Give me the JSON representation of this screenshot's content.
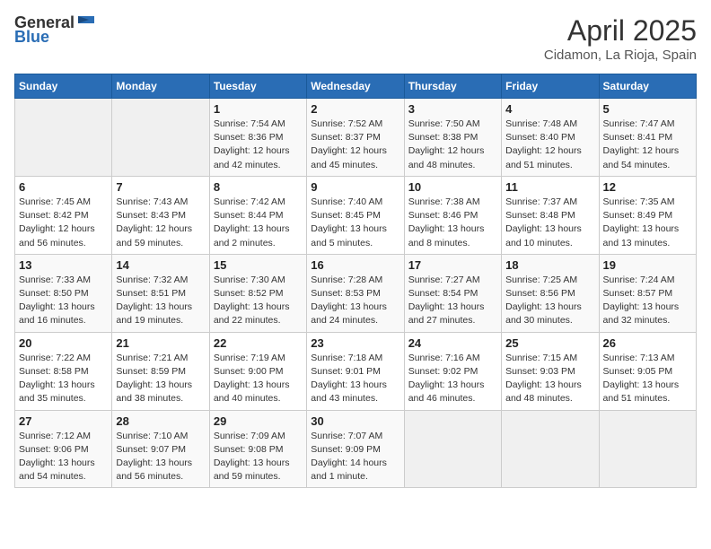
{
  "header": {
    "logo_general": "General",
    "logo_blue": "Blue",
    "month": "April 2025",
    "location": "Cidamon, La Rioja, Spain"
  },
  "weekdays": [
    "Sunday",
    "Monday",
    "Tuesday",
    "Wednesday",
    "Thursday",
    "Friday",
    "Saturday"
  ],
  "weeks": [
    [
      {
        "day": "",
        "info": ""
      },
      {
        "day": "",
        "info": ""
      },
      {
        "day": "1",
        "info": "Sunrise: 7:54 AM\nSunset: 8:36 PM\nDaylight: 12 hours and 42 minutes."
      },
      {
        "day": "2",
        "info": "Sunrise: 7:52 AM\nSunset: 8:37 PM\nDaylight: 12 hours and 45 minutes."
      },
      {
        "day": "3",
        "info": "Sunrise: 7:50 AM\nSunset: 8:38 PM\nDaylight: 12 hours and 48 minutes."
      },
      {
        "day": "4",
        "info": "Sunrise: 7:48 AM\nSunset: 8:40 PM\nDaylight: 12 hours and 51 minutes."
      },
      {
        "day": "5",
        "info": "Sunrise: 7:47 AM\nSunset: 8:41 PM\nDaylight: 12 hours and 54 minutes."
      }
    ],
    [
      {
        "day": "6",
        "info": "Sunrise: 7:45 AM\nSunset: 8:42 PM\nDaylight: 12 hours and 56 minutes."
      },
      {
        "day": "7",
        "info": "Sunrise: 7:43 AM\nSunset: 8:43 PM\nDaylight: 12 hours and 59 minutes."
      },
      {
        "day": "8",
        "info": "Sunrise: 7:42 AM\nSunset: 8:44 PM\nDaylight: 13 hours and 2 minutes."
      },
      {
        "day": "9",
        "info": "Sunrise: 7:40 AM\nSunset: 8:45 PM\nDaylight: 13 hours and 5 minutes."
      },
      {
        "day": "10",
        "info": "Sunrise: 7:38 AM\nSunset: 8:46 PM\nDaylight: 13 hours and 8 minutes."
      },
      {
        "day": "11",
        "info": "Sunrise: 7:37 AM\nSunset: 8:48 PM\nDaylight: 13 hours and 10 minutes."
      },
      {
        "day": "12",
        "info": "Sunrise: 7:35 AM\nSunset: 8:49 PM\nDaylight: 13 hours and 13 minutes."
      }
    ],
    [
      {
        "day": "13",
        "info": "Sunrise: 7:33 AM\nSunset: 8:50 PM\nDaylight: 13 hours and 16 minutes."
      },
      {
        "day": "14",
        "info": "Sunrise: 7:32 AM\nSunset: 8:51 PM\nDaylight: 13 hours and 19 minutes."
      },
      {
        "day": "15",
        "info": "Sunrise: 7:30 AM\nSunset: 8:52 PM\nDaylight: 13 hours and 22 minutes."
      },
      {
        "day": "16",
        "info": "Sunrise: 7:28 AM\nSunset: 8:53 PM\nDaylight: 13 hours and 24 minutes."
      },
      {
        "day": "17",
        "info": "Sunrise: 7:27 AM\nSunset: 8:54 PM\nDaylight: 13 hours and 27 minutes."
      },
      {
        "day": "18",
        "info": "Sunrise: 7:25 AM\nSunset: 8:56 PM\nDaylight: 13 hours and 30 minutes."
      },
      {
        "day": "19",
        "info": "Sunrise: 7:24 AM\nSunset: 8:57 PM\nDaylight: 13 hours and 32 minutes."
      }
    ],
    [
      {
        "day": "20",
        "info": "Sunrise: 7:22 AM\nSunset: 8:58 PM\nDaylight: 13 hours and 35 minutes."
      },
      {
        "day": "21",
        "info": "Sunrise: 7:21 AM\nSunset: 8:59 PM\nDaylight: 13 hours and 38 minutes."
      },
      {
        "day": "22",
        "info": "Sunrise: 7:19 AM\nSunset: 9:00 PM\nDaylight: 13 hours and 40 minutes."
      },
      {
        "day": "23",
        "info": "Sunrise: 7:18 AM\nSunset: 9:01 PM\nDaylight: 13 hours and 43 minutes."
      },
      {
        "day": "24",
        "info": "Sunrise: 7:16 AM\nSunset: 9:02 PM\nDaylight: 13 hours and 46 minutes."
      },
      {
        "day": "25",
        "info": "Sunrise: 7:15 AM\nSunset: 9:03 PM\nDaylight: 13 hours and 48 minutes."
      },
      {
        "day": "26",
        "info": "Sunrise: 7:13 AM\nSunset: 9:05 PM\nDaylight: 13 hours and 51 minutes."
      }
    ],
    [
      {
        "day": "27",
        "info": "Sunrise: 7:12 AM\nSunset: 9:06 PM\nDaylight: 13 hours and 54 minutes."
      },
      {
        "day": "28",
        "info": "Sunrise: 7:10 AM\nSunset: 9:07 PM\nDaylight: 13 hours and 56 minutes."
      },
      {
        "day": "29",
        "info": "Sunrise: 7:09 AM\nSunset: 9:08 PM\nDaylight: 13 hours and 59 minutes."
      },
      {
        "day": "30",
        "info": "Sunrise: 7:07 AM\nSunset: 9:09 PM\nDaylight: 14 hours and 1 minute."
      },
      {
        "day": "",
        "info": ""
      },
      {
        "day": "",
        "info": ""
      },
      {
        "day": "",
        "info": ""
      }
    ]
  ]
}
